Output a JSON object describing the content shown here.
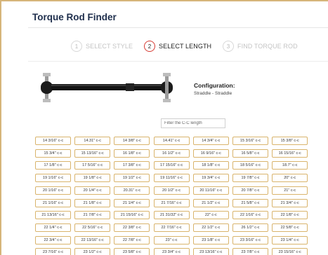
{
  "page": {
    "title": "Torque Rod Finder"
  },
  "steps": [
    {
      "num": "1",
      "label": "SELECT STYLE",
      "state": "done"
    },
    {
      "num": "2",
      "label": "SELECT LENGTH",
      "state": "active"
    },
    {
      "num": "3",
      "label": "FIND TORQUE ROD",
      "state": "pending"
    }
  ],
  "colors": {
    "accent_border": "#d9b46c",
    "active_step_ring": "#d63a32",
    "title_text": "#1f2f4d"
  },
  "configuration": {
    "label": "Configuration:",
    "value": "Straddle - Straddle"
  },
  "filter": {
    "placeholder": "Filter the C-C length",
    "value": ""
  },
  "lengths": [
    [
      "14 3/16\" c-c",
      "14.31\" c-c",
      "14 3/8\" c-c",
      "14.41\" c-c",
      "14 3/4\" c-c",
      "15 3/16\" c-c",
      "15 3/8\" c-c"
    ],
    [
      "15 3/4\" c-c",
      "15 13/16\" c-c",
      "16 1/8\" c-c",
      "16 1/2\" c-c",
      "16 9/16\" c-c",
      "16 5/8\" c-c",
      "16 15/16\" c-c"
    ],
    [
      "17 1/8\" c-c",
      "17 5/16\" c-c",
      "17 3/8\" c-c",
      "17 15/16\" c-c",
      "18 1/8\" c-c",
      "18 5/16\" c-c",
      "18.7\" c-c"
    ],
    [
      "19 1/16\" c-c",
      "19 1/8\" c-c",
      "19 1/2\" c-c",
      "19 11/16\" c-c",
      "19 3/4\" c-c",
      "19 7/8\" c-c",
      "20\" c-c"
    ],
    [
      "20 1/16\" c-c",
      "20 1/4\" c-c",
      "20.31\" c-c",
      "20 1/2\" c-c",
      "20 11/16\" c-c",
      "20 7/8\" c-c",
      "21\" c-c"
    ],
    [
      "21 1/16\" c-c",
      "21 1/8\" c-c",
      "21 1/4\" c-c",
      "21 7/16\" c-c",
      "21 1/2\" c-c",
      "21 5/8\" c-c",
      "21 3/4\" c-c"
    ],
    [
      "21 13/16\" c-c",
      "21 7/8\" c-c",
      "21 15/16\" c-c",
      "21 31/32\" c-c",
      "22\" c-c",
      "22 1/16\" c-c",
      "22 1/8\" c-c"
    ],
    [
      "22 1/4\" c-c",
      "22 5/16\" c-c",
      "22 3/8\" c-c",
      "22 7/16\" c-c",
      "22 1/2\" c-c",
      "26 1/2\" c-c",
      "22 5/8\" c-c"
    ],
    [
      "22 3/4\" c-c",
      "22 13/16\" c-c",
      "22 7/8\" c-c",
      "23\" c-c",
      "23 1/8\" c-c",
      "23 3/16\" c-c",
      "23 1/4\" c-c"
    ],
    [
      "23 7/16\" c-c",
      "23 1/2\" c-c",
      "23 5/8\" c-c",
      "23 3/4\" c-c",
      "23 13/16\" c-c",
      "23 7/8\" c-c",
      "23 15/16\" c-c"
    ]
  ]
}
